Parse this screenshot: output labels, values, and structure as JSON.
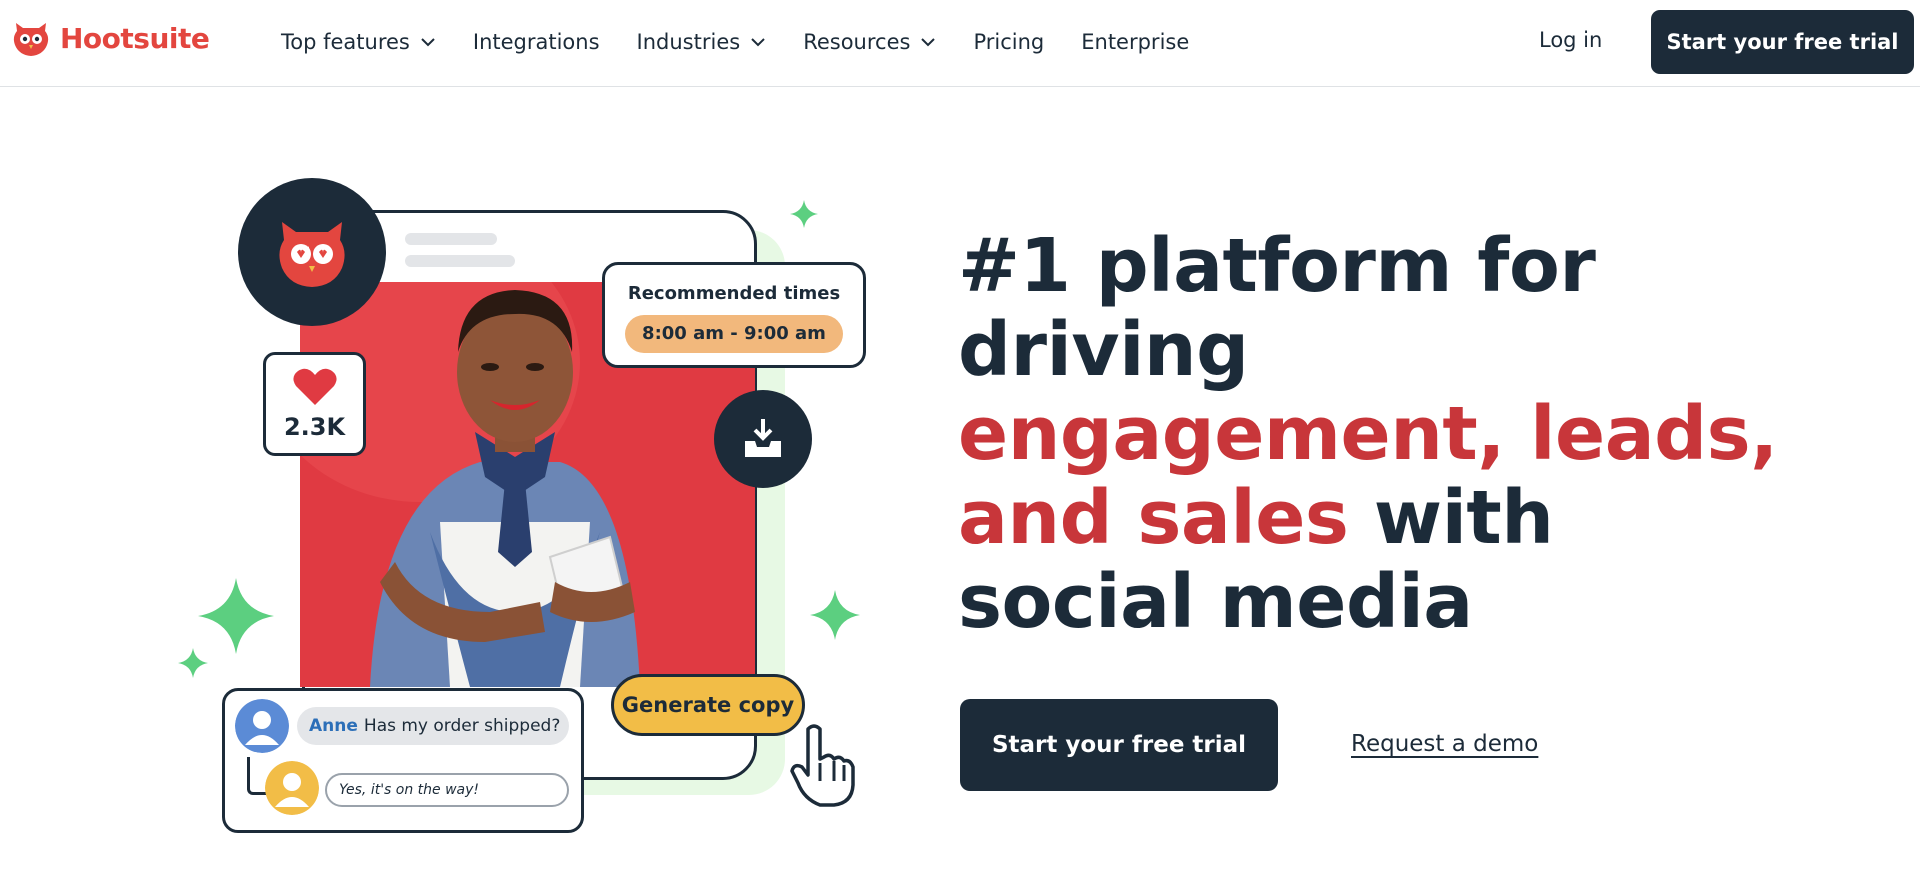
{
  "header": {
    "brand": "Hootsuite",
    "nav": [
      {
        "label": "Top features",
        "has_dropdown": true
      },
      {
        "label": "Integrations",
        "has_dropdown": false
      },
      {
        "label": "Industries",
        "has_dropdown": true
      },
      {
        "label": "Resources",
        "has_dropdown": true
      },
      {
        "label": "Pricing",
        "has_dropdown": false
      },
      {
        "label": "Enterprise",
        "has_dropdown": false
      }
    ],
    "login_label": "Log in",
    "cta_label": "Start your free trial"
  },
  "hero": {
    "headline_part1": "#1 platform for driving",
    "headline_accent": "engagement, leads, and sales",
    "headline_part2": "with social media",
    "primary_cta": "Start your free trial",
    "secondary_cta": "Request a demo"
  },
  "illustration": {
    "like_count": "2.3K",
    "recommended_title": "Recommended times",
    "recommended_time": "8:00 am - 9:00 am",
    "chat_name": "Anne",
    "chat_message": "Has my order shipped?",
    "reply_message": "Yes, it's on the way!",
    "generate_label": "Generate copy"
  },
  "colors": {
    "brand_red": "#e3463f",
    "accent_red": "#c8363a",
    "navy": "#1c2b39",
    "sparkle_green": "#5ccf80",
    "pill_orange": "#f2b87c",
    "generate_yellow": "#f2bd47"
  }
}
